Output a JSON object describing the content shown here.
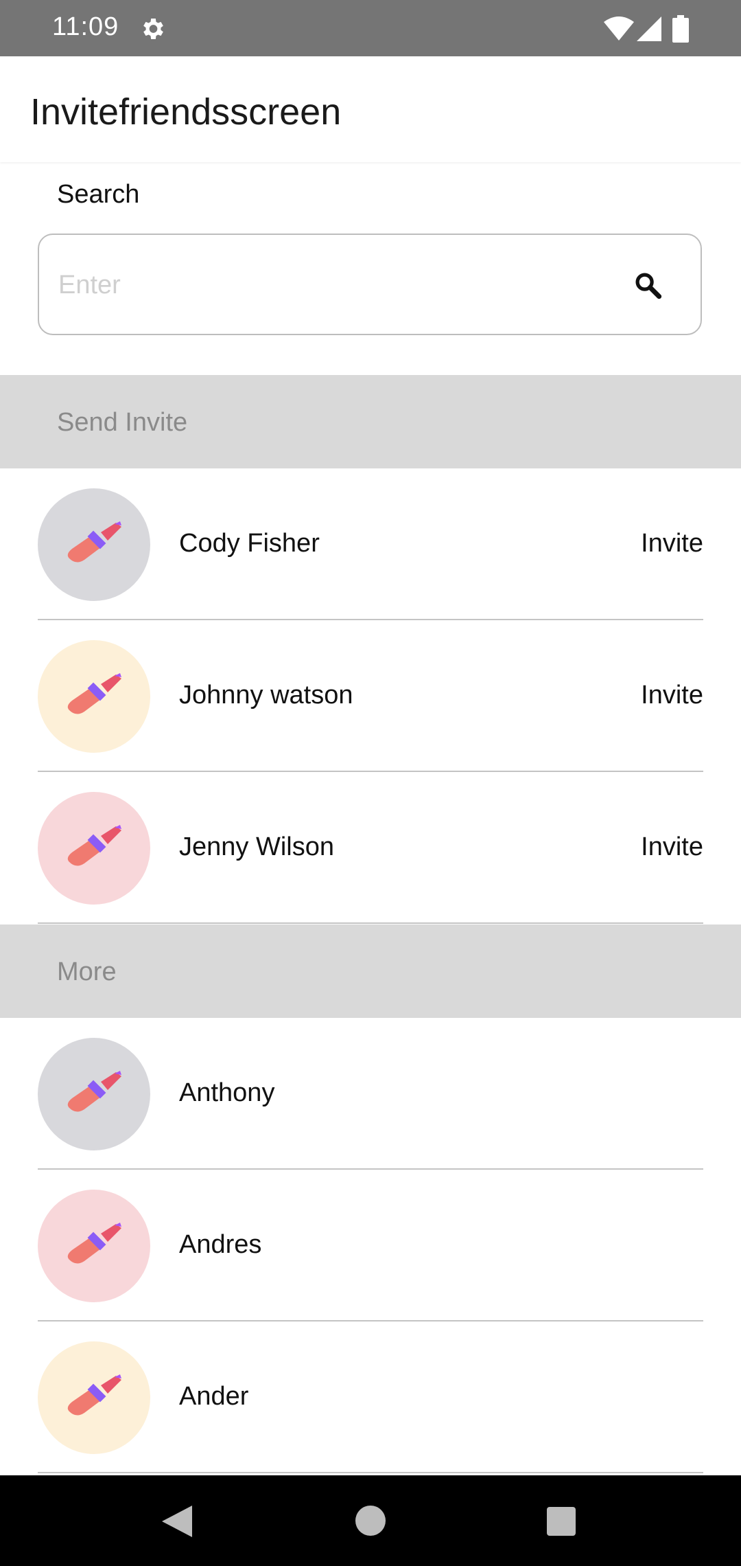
{
  "status_bar": {
    "time": "11:09",
    "icons": [
      "gear-icon",
      "wifi-icon",
      "signal-icon",
      "battery-icon"
    ]
  },
  "app_bar": {
    "title": "Invitefriendsscreen"
  },
  "search": {
    "label": "Search",
    "placeholder": "Enter",
    "value": "",
    "icon": "search-icon"
  },
  "sections": {
    "send_invite": {
      "header": "Send Invite",
      "contacts": [
        {
          "name": "Cody Fisher",
          "action": "Invite",
          "avatar_bg": "#d8d8dc"
        },
        {
          "name": "Johnny watson",
          "action": "Invite",
          "avatar_bg": "#fdf0d8"
        },
        {
          "name": "Jenny Wilson",
          "action": "Invite",
          "avatar_bg": "#f8d7da"
        }
      ]
    },
    "more": {
      "header": "More",
      "contacts": [
        {
          "name": "Anthony",
          "avatar_bg": "#d8d8dc"
        },
        {
          "name": "Andres",
          "avatar_bg": "#f8d7da"
        },
        {
          "name": "Ander",
          "avatar_bg": "#fdf0d8"
        }
      ]
    }
  },
  "nav_bar": {
    "icons": [
      "back-icon",
      "home-icon",
      "recents-icon"
    ]
  },
  "colors": {
    "status_bar": "#757575",
    "section_header_bg": "#d9d9d9",
    "section_header_text": "#8a8a8a",
    "divider": "#c4c4c4"
  }
}
